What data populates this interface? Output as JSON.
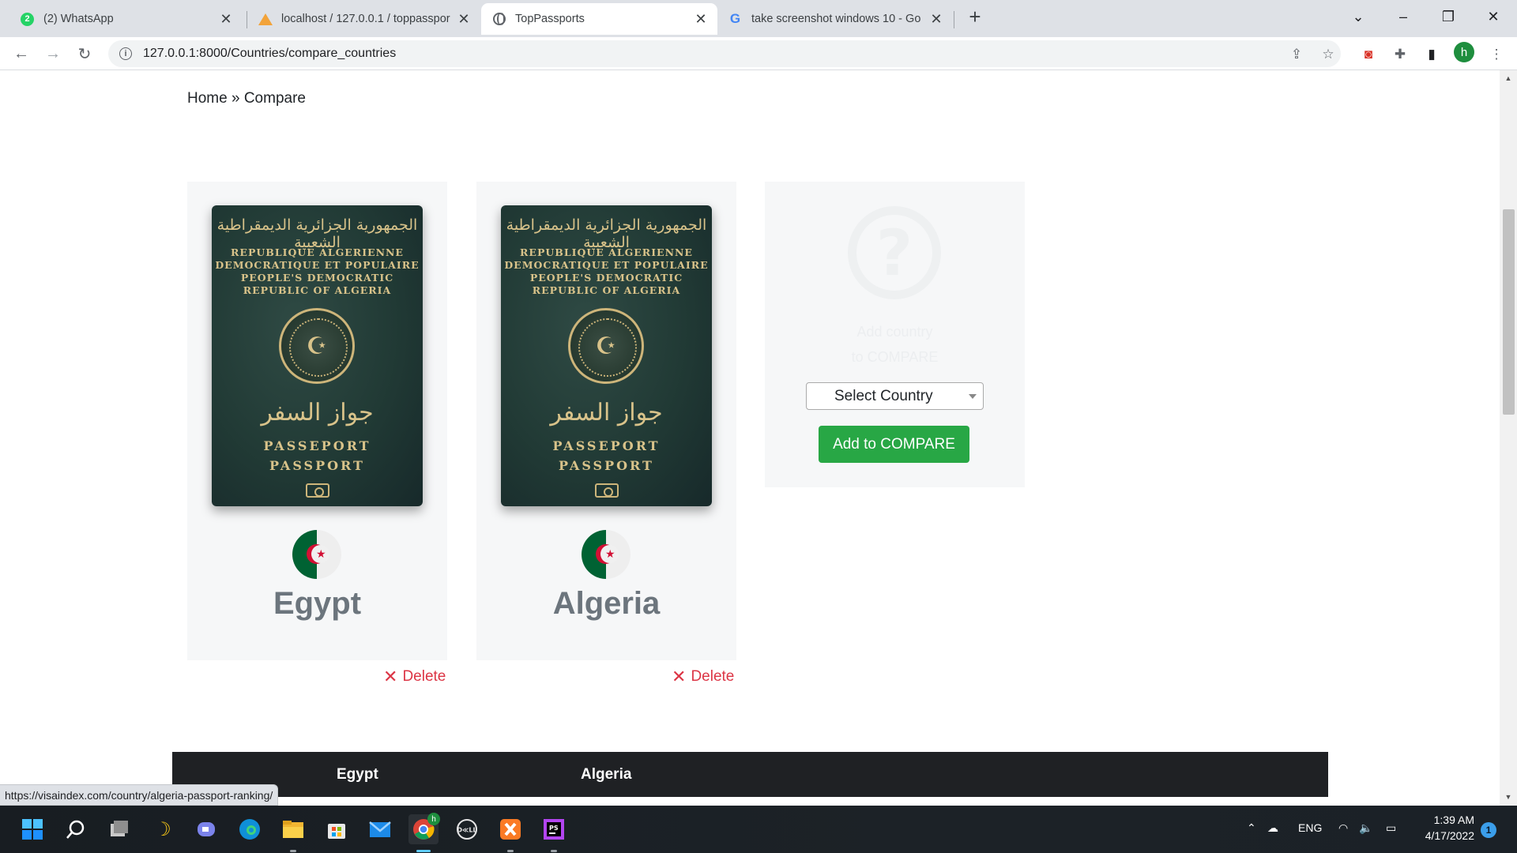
{
  "browser": {
    "tabs": [
      {
        "title": "(2) WhatsApp",
        "badge": "2",
        "icon": "whatsapp-icon"
      },
      {
        "title": "localhost / 127.0.0.1 / toppasspor",
        "icon": "phpmyadmin-icon"
      },
      {
        "title": "TopPassports",
        "icon": "globe-icon",
        "active": true
      },
      {
        "title": "take screenshot windows 10 - Go",
        "icon": "google-icon"
      }
    ],
    "url": "127.0.0.1:8000/Countries/compare_countries",
    "profile_initial": "h",
    "status_url": "https://visaindex.com/country/algeria-passport-ranking/"
  },
  "breadcrumb": {
    "home": "Home",
    "separator": "»",
    "current": "Compare"
  },
  "passport": {
    "arabic_title": "الجمهورية الجزائرية الديمقراطية الشعبية",
    "lines": [
      "REPUBLIQUE ALGERIENNE",
      "DEMOCRATIQUE ET POPULAIRE",
      "PEOPLE'S DEMOCRATIC",
      "REPUBLIC OF ALGERIA"
    ],
    "arabic_word": "جواز السفر",
    "word1": "PASSEPORT",
    "word2": "PASSPORT"
  },
  "countries": [
    {
      "name": "Egypt",
      "delete_label": "Delete"
    },
    {
      "name": "Algeria",
      "delete_label": "Delete"
    }
  ],
  "add_card": {
    "line1": "Add country",
    "line2": "to COMPARE",
    "select_value": "Select Country",
    "button_label": "Add to COMPARE"
  },
  "table_head": [
    "Egypt",
    "Algeria"
  ],
  "taskbar": {
    "language": "ENG",
    "time": "1:39 AM",
    "date": "4/17/2022",
    "notifications": "1",
    "chrome_badge": "h"
  },
  "colors": {
    "delete": "#dc3545",
    "button": "#28a745",
    "table_head": "#1f2124"
  }
}
